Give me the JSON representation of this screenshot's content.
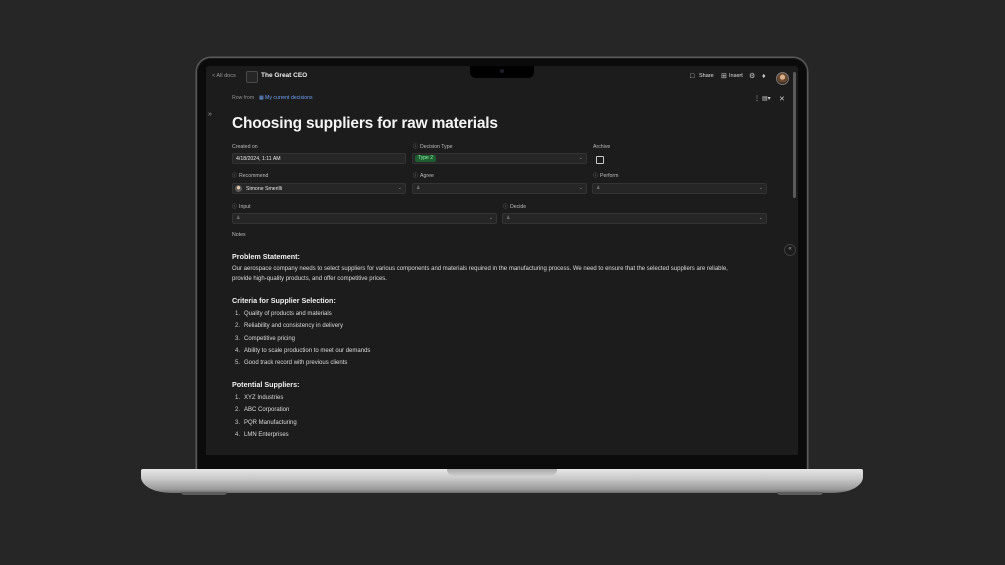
{
  "app": {
    "all_docs_label": "< All docs",
    "doc_title": "The Great CEO",
    "share_label": "Share",
    "insert_label": "Insert",
    "share_icon": "folder-icon",
    "insert_icon": "grid-icon",
    "settings_icon": "gear-icon",
    "notifications_icon": "bell-icon"
  },
  "row": {
    "row_from_label": "Row from",
    "row_from_link": "My current decisions"
  },
  "page": {
    "title": "Choosing suppliers for raw materials"
  },
  "fields": {
    "created_on": {
      "label": "Created on",
      "value": "4/18/2024, 1:11 AM"
    },
    "decision_type": {
      "label": "Decision Type",
      "value": "Type 2",
      "tag_color": "#1e5e31"
    },
    "archive": {
      "label": "Archive",
      "checked": false
    },
    "recommend": {
      "label": "Recommend",
      "value": "Simone Smerilli"
    },
    "agree": {
      "label": "Agree"
    },
    "perform": {
      "label": "Perform"
    },
    "input": {
      "label": "Input"
    },
    "decide": {
      "label": "Decide"
    }
  },
  "notes": {
    "label": "Notes",
    "problem_heading": "Problem Statement:",
    "problem_text_line1": "Our aerospace company needs to select suppliers for various components and materials required in the manufacturing process. We need to ensure that the selected suppliers are reliable,",
    "problem_text_line2": "provide high-quality products, and offer competitive prices.",
    "criteria_heading": "Criteria for Supplier Selection:",
    "criteria": [
      "Quality of products and materials",
      "Reliability and consistency in delivery",
      "Competitive pricing",
      "Ability to scale production to meet our demands",
      "Good track record with previous clients"
    ],
    "suppliers_heading": "Potential Suppliers:",
    "suppliers": [
      "XYZ Industries",
      "ABC Corporation",
      "PQR Manufacturing",
      "LMN Enterprises"
    ]
  },
  "colors": {
    "background": "#262626",
    "screen": "#1c1c1c",
    "link": "#6ea0f2",
    "tag_text": "#8ef0a6"
  }
}
